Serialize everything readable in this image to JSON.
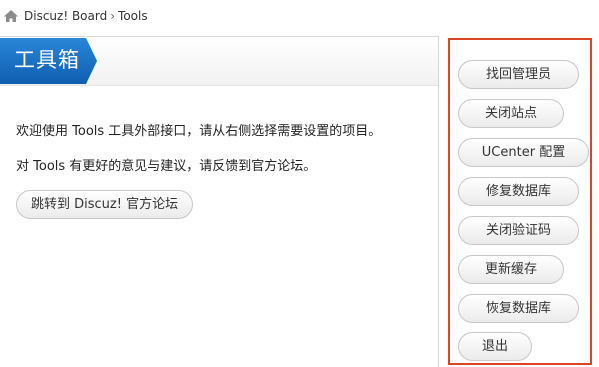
{
  "breadcrumb": {
    "home_icon": "home-icon",
    "site": "Discuz! Board",
    "separator": "›",
    "current": "Tools"
  },
  "main": {
    "title": "工具箱",
    "title_color": "#1a6fc4",
    "intro": "欢迎使用 Tools 工具外部接口，请从右侧选择需要设置的项目。",
    "feedback": "对 Tools 有更好的意见与建议，请反馈到官方论坛。",
    "jump_button": "跳转到 Discuz! 官方论坛"
  },
  "sidebar": {
    "highlight_color": "#dd4422",
    "items": [
      {
        "label": "找回管理员"
      },
      {
        "label": "关闭站点"
      },
      {
        "label": "UCenter 配置"
      },
      {
        "label": "修复数据库"
      },
      {
        "label": "关闭验证码"
      },
      {
        "label": "更新缓存"
      },
      {
        "label": "恢复数据库"
      },
      {
        "label": "退出"
      }
    ]
  }
}
